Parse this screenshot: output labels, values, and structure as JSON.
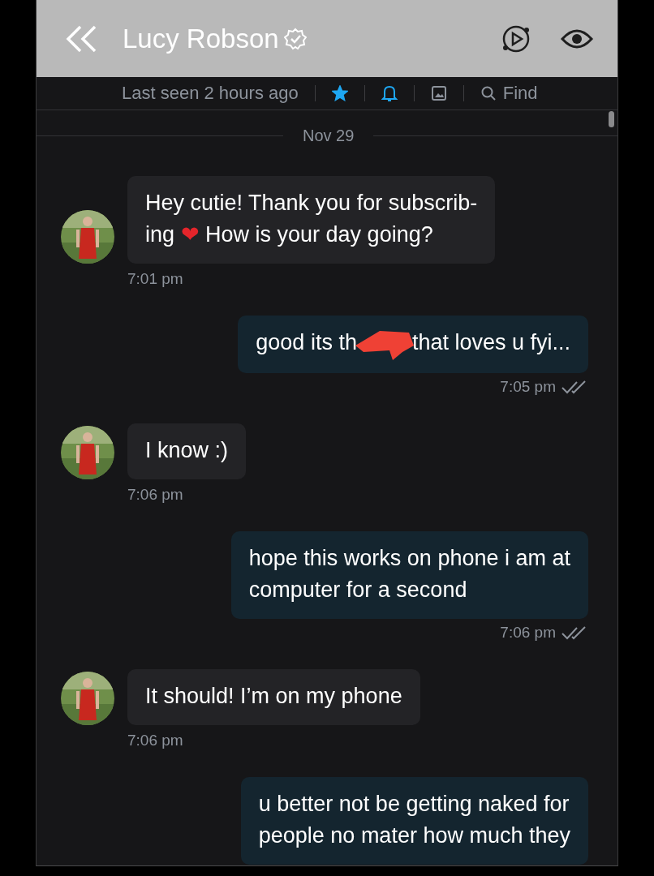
{
  "header": {
    "title": "Lucy Robson",
    "verified": true
  },
  "status": {
    "last_seen": "Last seen 2 hours ago",
    "starred": true,
    "notifications": true,
    "find_label": "Find"
  },
  "date_divider": "Nov 29",
  "messages": [
    {
      "kind": "incoming",
      "avatar": {
        "kind": "picture"
      },
      "lines": [
        [
          {
            "text": "Hey cutie! Thank you for subscrib-"
          }
        ],
        [
          {
            "text": "ing "
          },
          {
            "kind": "emoji",
            "text": "❤"
          },
          {
            "text": " How is your day going?"
          }
        ]
      ],
      "time": "7:01 pm"
    },
    {
      "kind": "outgoing",
      "read": true,
      "lines": [
        [
          {
            "text": "good its th"
          },
          {
            "kind": "redaction"
          },
          {
            "text": "that loves u fyi..."
          }
        ]
      ],
      "time": "7:05 pm"
    },
    {
      "kind": "incoming",
      "avatar": {
        "kind": "picture"
      },
      "lines": [
        [
          {
            "text": "I know :)"
          }
        ]
      ],
      "time": "7:06 pm"
    },
    {
      "kind": "outgoing",
      "read": true,
      "lines": [
        [
          {
            "text": "hope this works on phone i am at"
          }
        ],
        [
          {
            "text": "computer for a second"
          }
        ]
      ],
      "time": "7:06 pm"
    },
    {
      "kind": "incoming",
      "avatar": {
        "kind": "picture"
      },
      "lines": [
        [
          {
            "text": "It should! I’m on my phone"
          }
        ]
      ],
      "time": "7:06 pm"
    },
    {
      "kind": "outgoing",
      "lines": [
        [
          {
            "text": "u better not be getting naked for"
          }
        ],
        [
          {
            "text": "people no mater how much they"
          }
        ]
      ]
    }
  ]
}
